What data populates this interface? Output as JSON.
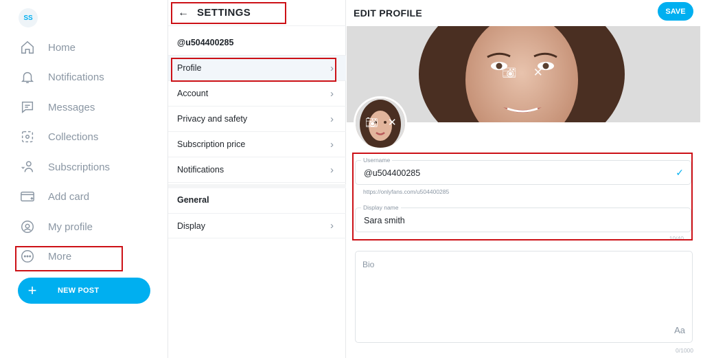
{
  "user": {
    "initials": "SS",
    "handle": "@u504400285",
    "display_name": "Sara smith",
    "url": "https://onlyfans.com/u504400285"
  },
  "nav": {
    "items": [
      {
        "label": "Home",
        "icon": "home-icon"
      },
      {
        "label": "Notifications",
        "icon": "bell-icon"
      },
      {
        "label": "Messages",
        "icon": "message-icon"
      },
      {
        "label": "Collections",
        "icon": "collections-icon"
      },
      {
        "label": "Subscriptions",
        "icon": "subscriptions-icon"
      },
      {
        "label": "Add card",
        "icon": "card-icon"
      },
      {
        "label": "My profile",
        "icon": "profile-icon"
      },
      {
        "label": "More",
        "icon": "more-icon"
      }
    ],
    "new_post": "NEW POST"
  },
  "settings": {
    "title": "SETTINGS",
    "items": [
      "Profile",
      "Account",
      "Privacy and safety",
      "Subscription price",
      "Notifications"
    ],
    "section": "General",
    "general_items": [
      "Display"
    ]
  },
  "edit": {
    "title": "EDIT PROFILE",
    "save": "SAVE",
    "username_label": "Username",
    "display_name_label": "Display name",
    "display_name_count": "10/40",
    "bio_placeholder": "Bio",
    "bio_format": "Aa",
    "bio_count": "0/1000"
  },
  "colors": {
    "accent": "#00aff0",
    "highlight": "#cc1016"
  }
}
